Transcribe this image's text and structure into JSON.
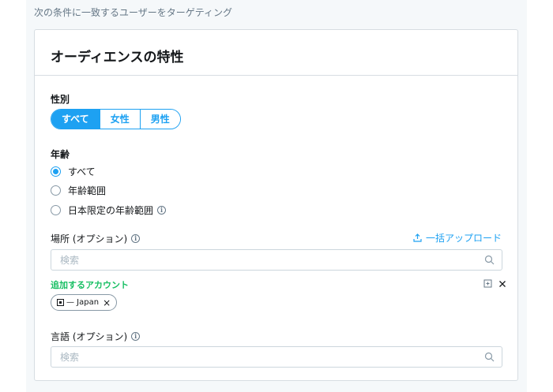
{
  "header": {
    "text": "次の条件に一致するユーザーをターゲティング"
  },
  "card": {
    "title": "オーディエンスの特性"
  },
  "gender": {
    "label": "性別",
    "options": [
      {
        "label": "すべて",
        "active": true
      },
      {
        "label": "女性",
        "active": false
      },
      {
        "label": "男性",
        "active": false
      }
    ]
  },
  "age": {
    "label": "年齢",
    "options": [
      {
        "label": "すべて",
        "checked": true
      },
      {
        "label": "年齢範囲",
        "checked": false
      },
      {
        "label": "日本限定の年齢範囲",
        "checked": false,
        "info": true
      }
    ]
  },
  "location": {
    "label": "場所 (オプション)",
    "bulk_upload": "一括アップロード",
    "search_placeholder": "検索",
    "added_label": "追加するアカウント",
    "chips": [
      {
        "label": "— Japan"
      }
    ]
  },
  "language": {
    "label": "言語 (オプション)",
    "search_placeholder": "検索"
  },
  "colors": {
    "accent": "#1da1f2",
    "success": "#17bf63",
    "border": "#ccd6dd",
    "muted": "#657786"
  },
  "icons": {
    "info": "info-icon",
    "upload": "upload-icon",
    "search": "search-icon",
    "copy": "copy-icon",
    "close": "close-icon",
    "flag": "flag-icon"
  }
}
